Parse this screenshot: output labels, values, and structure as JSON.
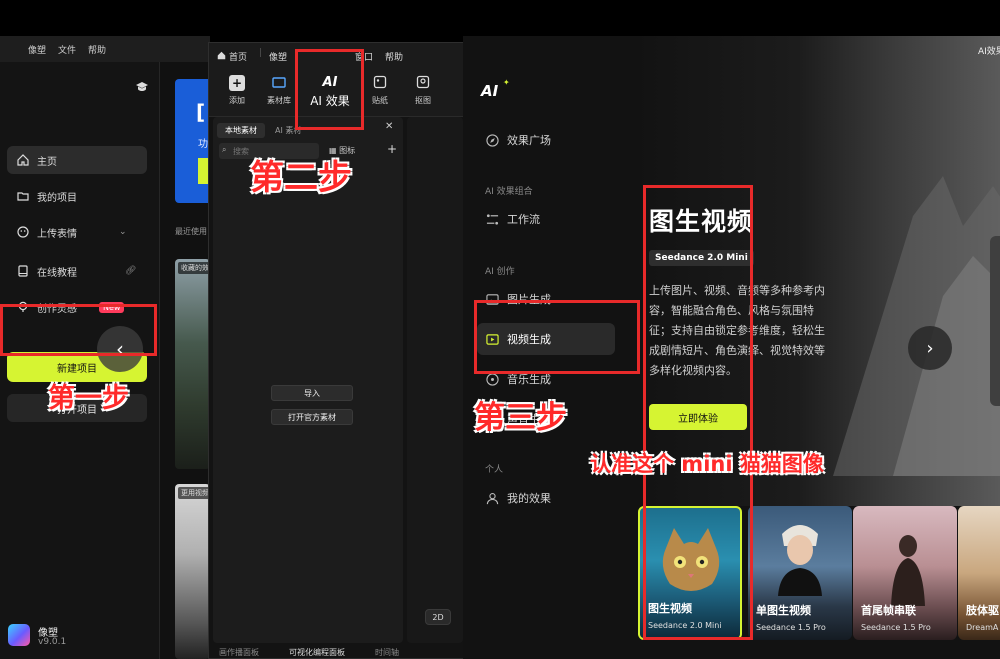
{
  "w1": {
    "menu": [
      "像塑",
      "文件",
      "帮助"
    ],
    "sidebar": [
      {
        "label": "主页",
        "icon": "home-icon"
      },
      {
        "label": "我的项目",
        "icon": "folder-icon"
      },
      {
        "label": "上传表情",
        "icon": "emoji-icon"
      },
      {
        "label": "在线教程",
        "icon": "book-icon"
      },
      {
        "label": "创作灵感",
        "icon": "bulb-icon",
        "badge": "New"
      }
    ],
    "new_project": "新建项目",
    "open_project": "打开项目",
    "app_name": "像塑",
    "app_version": "v9.0.1",
    "banner_t1": "[",
    "banner_t2": "功",
    "recent_label": "最近使用",
    "thumb_tags": [
      "收藏的效",
      "更用视频"
    ]
  },
  "w2": {
    "top": {
      "home": "首页",
      "app": "像塑",
      "window": "窗口",
      "help": "帮助"
    },
    "tools": [
      {
        "label": "添加",
        "icon": "plus-icon"
      },
      {
        "label": "素材库",
        "icon": "library-icon"
      },
      {
        "label": "贴纸",
        "icon": "sticker-icon"
      },
      {
        "label": "抠图",
        "icon": "cutout-icon"
      }
    ],
    "ai_badge": "AI",
    "ai_label": "AI 效果",
    "media_tab_local": "本地素材",
    "media_tab_other": "AI 素材",
    "search_placeholder": "搜索",
    "view_mode": "图标",
    "import": "导入",
    "open_official": "打开官方素材",
    "btn_2d": "2D",
    "bottom": [
      "画作播面板",
      "可视化编程面板",
      "时间轴"
    ]
  },
  "w3": {
    "title": "AI效果",
    "logo": "AI",
    "nav": {
      "effects_plaza": "效果广场",
      "combo_head": "AI 效果组合",
      "workflow": "工作流",
      "create_head": "AI 创作",
      "image_gen": "图片生成",
      "video_gen": "视频生成",
      "music_gen": "音乐生成",
      "sound_gen": "声音生成",
      "personal_head": "个人",
      "my_effects": "我的效果"
    },
    "hero": {
      "title": "图生视频",
      "badge": "Seedance 2.0 Mini",
      "desc": "上传图片、视频、音频等多种参考内容，智能融合角色、风格与氛围特征；支持自由锁定参考维度，轻松生成剧情短片、角色演绎、视觉特效等多样化视频内容。",
      "cta": "立即体验"
    },
    "cards": [
      {
        "title": "图生视频",
        "sub": "Seedance 2.0 Mini"
      },
      {
        "title": "单图生视频",
        "sub": "Seedance 1.5 Pro"
      },
      {
        "title": "首尾帧串联",
        "sub": "Seedance 1.5 Pro"
      },
      {
        "title": "肢体驱",
        "sub": "DreamA"
      }
    ]
  },
  "annotations": {
    "step1": "第一步",
    "step2": "第二步",
    "step3": "第三步",
    "note": "认准这个 mini 猫猫图像"
  },
  "colors": {
    "accent": "#d6f432",
    "annotation": "#e82a2a"
  }
}
